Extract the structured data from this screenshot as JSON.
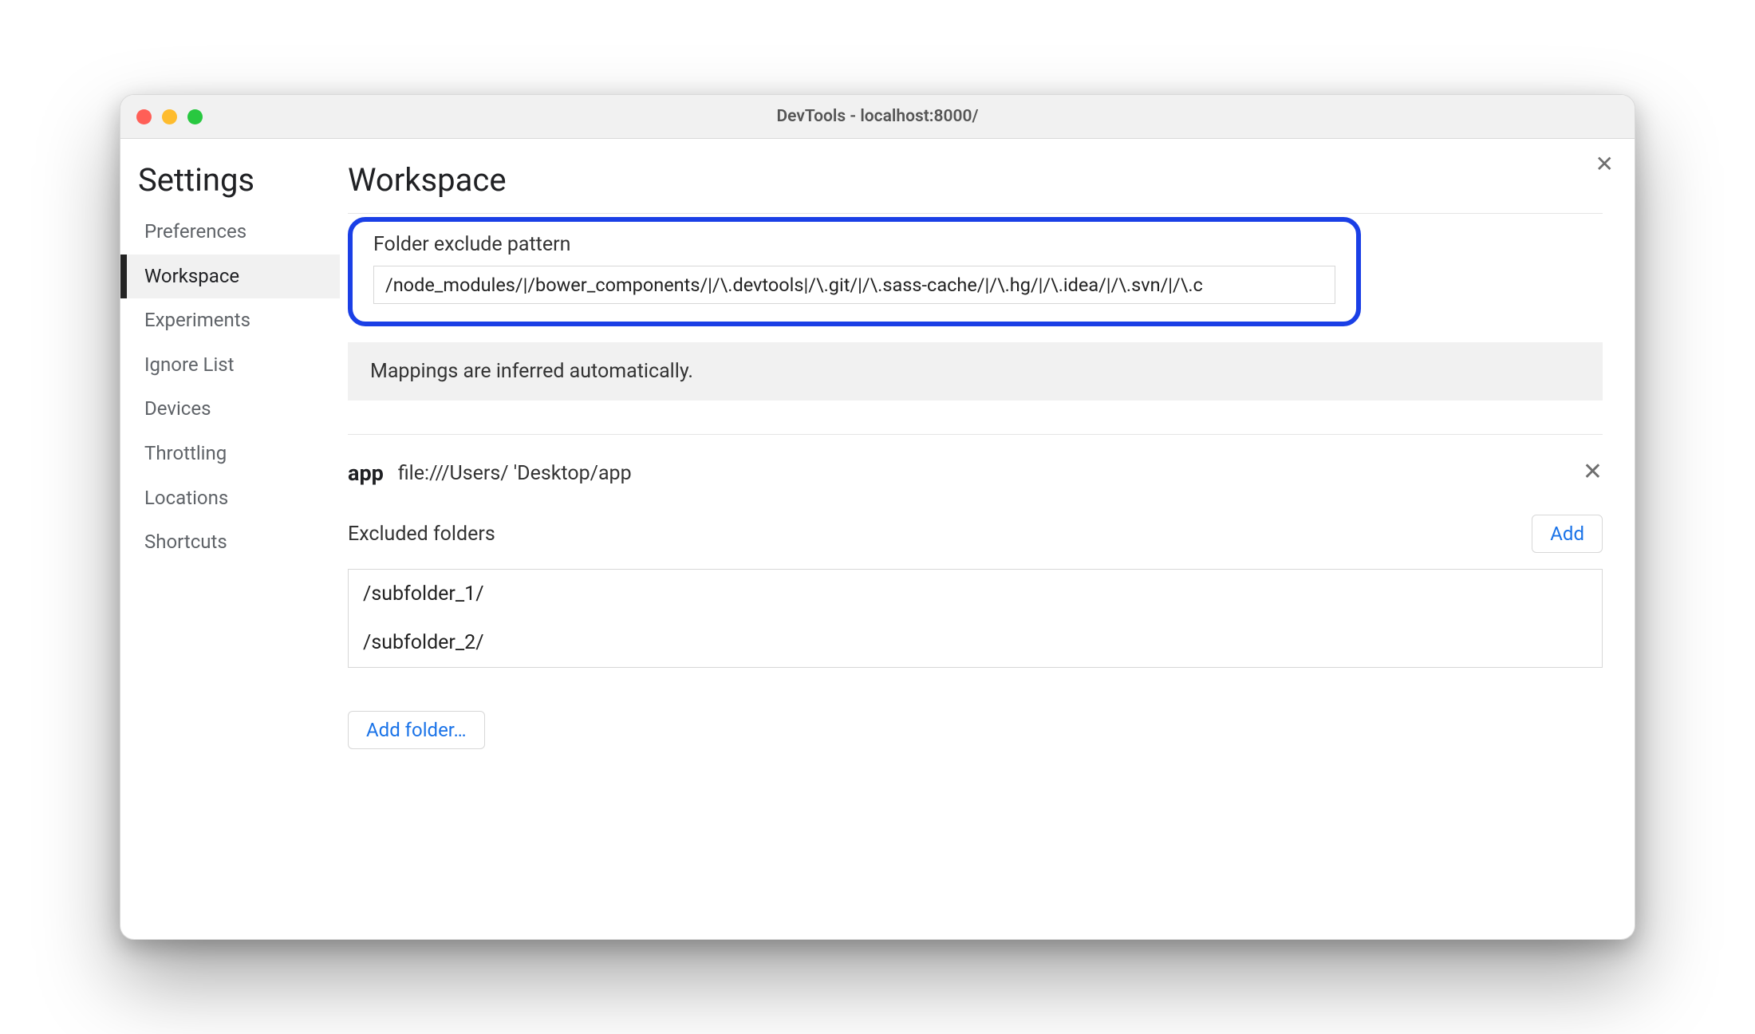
{
  "window": {
    "title": "DevTools - localhost:8000/"
  },
  "sidebar": {
    "title": "Settings",
    "items": [
      {
        "label": "Preferences",
        "active": false
      },
      {
        "label": "Workspace",
        "active": true
      },
      {
        "label": "Experiments",
        "active": false
      },
      {
        "label": "Ignore List",
        "active": false
      },
      {
        "label": "Devices",
        "active": false
      },
      {
        "label": "Throttling",
        "active": false
      },
      {
        "label": "Locations",
        "active": false
      },
      {
        "label": "Shortcuts",
        "active": false
      }
    ]
  },
  "main": {
    "title": "Workspace",
    "exclude_label": "Folder exclude pattern",
    "exclude_value": "/node_modules/|/bower_components/|/\\.devtools|/\\.git/|/\\.sass-cache/|/\\.hg/|/\\.idea/|/\\.svn/|/\\.c",
    "hint": "Mappings are inferred automatically.",
    "folder": {
      "name": "app",
      "path": "file:///Users/        'Desktop/app"
    },
    "excluded_label": "Excluded folders",
    "add_btn": "Add",
    "excluded_items": [
      "/subfolder_1/",
      "/subfolder_2/"
    ],
    "add_folder_btn": "Add folder…"
  },
  "icons": {
    "close_x": "✕"
  }
}
